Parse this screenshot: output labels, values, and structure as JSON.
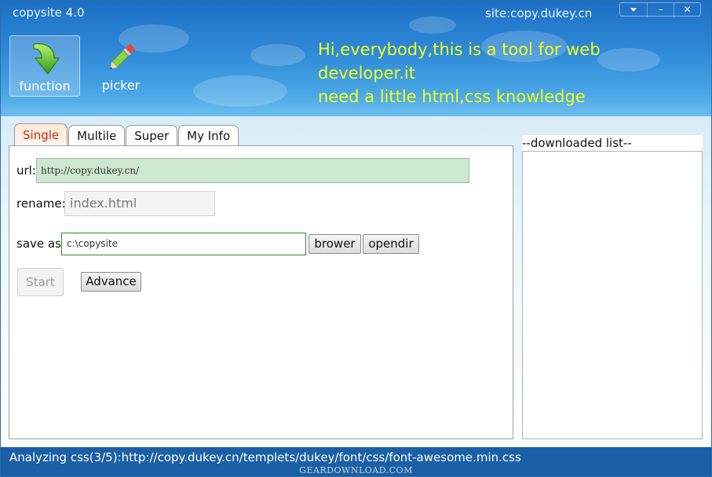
{
  "window": {
    "title": "copysite 4.0",
    "site": "site:copy.dukey.cn",
    "controls": {
      "menu": "⏷",
      "minimize": "–",
      "close": "✕"
    }
  },
  "toolbar": {
    "function_label": "function",
    "picker_label": "picker",
    "message_line1": "Hi,everybody,this is a tool for web developer.it",
    "message_line2": "need a little html,css knowledge"
  },
  "tabs": [
    {
      "label": "Single",
      "active": true
    },
    {
      "label": "Multile",
      "active": false
    },
    {
      "label": "Super",
      "active": false
    },
    {
      "label": "My Info",
      "active": false
    }
  ],
  "form": {
    "url_label": "url:",
    "url_value": "http://copy.dukey.cn/",
    "rename_label": "rename:",
    "rename_placeholder": "index.html",
    "saveas_label": "save as:",
    "saveas_value": "c:\\copysite",
    "brower_label": "brower",
    "opendir_label": "opendir",
    "start_label": "Start",
    "advance_label": "Advance"
  },
  "downloaded": {
    "header": "--downloaded list--",
    "items": []
  },
  "status": {
    "text": "Analyzing css(3/5):http://copy.dukey.cn/templets/dukey/font/css/font-awesome.min.css",
    "watermark": "GEARDOWNLOAD.COM"
  },
  "colors": {
    "header_blue": "#2f8ad8",
    "marquee_yellow": "#f2ff1f",
    "active_tab_red": "#d02a10",
    "url_field_green": "#cce8cf",
    "status_bar_blue": "#1b5fa6"
  },
  "icons": {
    "function": "green-down-arrow-icon",
    "picker": "pencil-icon"
  }
}
